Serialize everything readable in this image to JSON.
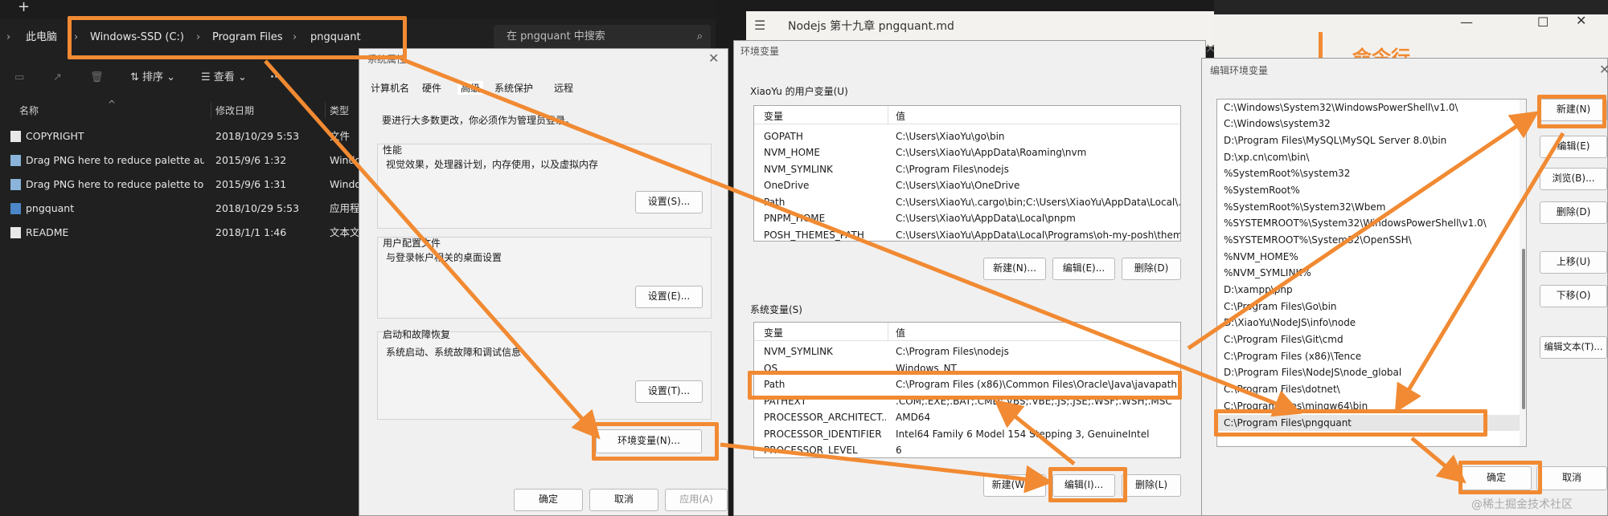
{
  "explorer": {
    "breadcrumb": [
      "此电脑",
      "Windows-SSD (C:)",
      "Program Files",
      "pngquant"
    ],
    "search_placeholder": "在 pngquant 中搜索",
    "toolbar": {
      "sort": "排序",
      "view": "查看",
      "more": "···"
    },
    "columns": {
      "name": "名称",
      "date": "修改日期",
      "type": "类型"
    },
    "files": [
      {
        "name": "COPYRIGHT",
        "date": "2018/10/29 5:53",
        "type": "文件"
      },
      {
        "name": "Drag PNG here to reduce palette aut...",
        "date": "2015/9/6 1:32",
        "type": "Windo"
      },
      {
        "name": "Drag PNG here to reduce palette to ...",
        "date": "2015/9/6 1:31",
        "type": "Windo"
      },
      {
        "name": "pngquant",
        "date": "2018/10/29 5:53",
        "type": "应用程"
      },
      {
        "name": "README",
        "date": "2018/1/1 1:46",
        "type": "文本文"
      }
    ]
  },
  "sysprop": {
    "title": "系统属性",
    "tabs": [
      "计算机名",
      "硬件",
      "高级",
      "系统保护",
      "远程"
    ],
    "admin_note": "要进行大多数更改，你必须作为管理员登录。",
    "performance": {
      "title": "性能",
      "desc": "视觉效果，处理器计划，内存使用，以及虚拟内存",
      "button": "设置(S)..."
    },
    "profile": {
      "title": "用户配置文件",
      "desc": "与登录帐户相关的桌面设置",
      "button": "设置(E)..."
    },
    "startup": {
      "title": "启动和故障恢复",
      "desc": "系统启动、系统故障和调试信息",
      "button": "设置(T)..."
    },
    "env_button": "环境变量(N)...",
    "ok": "确定",
    "cancel": "取消",
    "apply": "应用(A)"
  },
  "typora": {
    "title": "Nodejs 第十九章 pngquant.md"
  },
  "envvars": {
    "title": "环境变量",
    "user_label": "XiaoYu 的用户变量(U)",
    "col_var": "变量",
    "col_val": "值",
    "user_vars": [
      {
        "k": "GOPATH",
        "v": "C:\\Users\\XiaoYu\\go\\bin"
      },
      {
        "k": "NVM_HOME",
        "v": "C:\\Users\\XiaoYu\\AppData\\Roaming\\nvm"
      },
      {
        "k": "NVM_SYMLINK",
        "v": "C:\\Program Files\\nodejs"
      },
      {
        "k": "OneDrive",
        "v": "C:\\Users\\XiaoYu\\OneDrive"
      },
      {
        "k": "Path",
        "v": "C:\\Users\\XiaoYu\\.cargo\\bin;C:\\Users\\XiaoYu\\AppData\\Local\\..."
      },
      {
        "k": "PNPM_HOME",
        "v": "C:\\Users\\XiaoYu\\AppData\\Local\\pnpm"
      },
      {
        "k": "POSH_THEMES_PATH",
        "v": "C:\\Users\\XiaoYu\\AppData\\Local\\Programs\\oh-my-posh\\them..."
      }
    ],
    "user_buttons": {
      "new": "新建(N)...",
      "edit": "编辑(E)...",
      "delete": "删除(D)"
    },
    "sys_label": "系统变量(S)",
    "sys_vars": [
      {
        "k": "NVM_SYMLINK",
        "v": "C:\\Program Files\\nodejs"
      },
      {
        "k": "OS",
        "v": "Windows_NT"
      },
      {
        "k": "Path",
        "v": "C:\\Program Files (x86)\\Common Files\\Oracle\\Java\\javapath;C:..."
      },
      {
        "k": "PATHEXT",
        "v": ".COM;.EXE;.BAT;.CMD;.VBS;.VBE;.JS;.JSE;.WSF;.WSH;.MSC"
      },
      {
        "k": "PROCESSOR_ARCHITECT...",
        "v": "AMD64"
      },
      {
        "k": "PROCESSOR_IDENTIFIER",
        "v": "Intel64 Family 6 Model 154 Stepping 3, GenuineIntel"
      },
      {
        "k": "PROCESSOR_LEVEL",
        "v": "6"
      }
    ],
    "sys_buttons": {
      "new": "新建(W)...",
      "edit": "编辑(I)...",
      "delete": "删除(L)"
    }
  },
  "editenv": {
    "title": "编辑环境变量",
    "paths": [
      "C:\\Windows\\System32\\WindowsPowerShell\\v1.0\\",
      "C:\\Windows\\system32",
      "D:\\Program Files\\MySQL\\MySQL Server 8.0\\bin",
      "D:\\xp.cn\\com\\bin\\",
      "%SystemRoot%\\system32",
      "%SystemRoot%",
      "%SystemRoot%\\System32\\Wbem",
      "%SYSTEMROOT%\\System32\\WindowsPowerShell\\v1.0\\",
      "%SYSTEMROOT%\\System32\\OpenSSH\\",
      "%NVM_HOME%",
      "%NVM_SYMLINK%",
      "D:\\xampp\\php",
      "C:\\Program Files\\Go\\bin",
      "D:\\XiaoYu\\NodeJS\\info\\node",
      "C:\\Program Files\\Git\\cmd",
      "C:\\Program Files (x86)\\Tence",
      "D:\\Program Files\\NodeJS\\node_global",
      "C:\\Program Files\\dotnet\\",
      "C:\\Program Files\\mingw64\\bin",
      "C:\\Program Files\\pngquant"
    ],
    "buttons": [
      "新建(N)",
      "编辑(E)",
      "浏览(B)...",
      "删除(D)",
      "上移(U)",
      "下移(O)",
      "编辑文本(T)..."
    ],
    "ok": "确定",
    "cancel": "取消"
  },
  "bg_text": "命令行",
  "watermark": "@稀土掘金技术社区",
  "colors": {
    "annotation": "#f18a32",
    "explorer_bg": "#202020",
    "dialog_bg": "#f0f0f0"
  }
}
